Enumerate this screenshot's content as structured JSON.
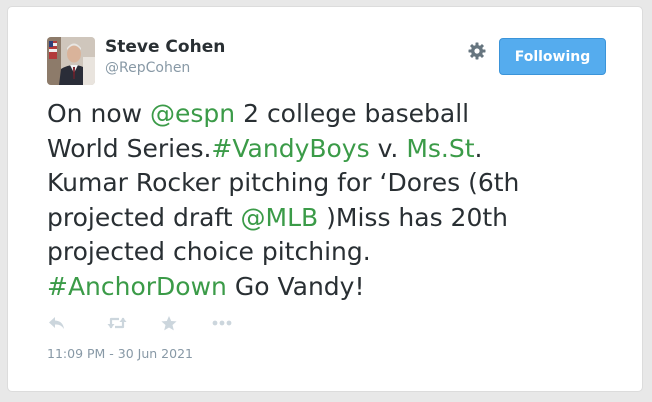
{
  "user": {
    "name": "Steve Cohen",
    "handle": "@RepCohen"
  },
  "follow_button": {
    "label": "Following"
  },
  "tweet": {
    "lines": [
      [
        {
          "text": "On now ",
          "type": "text"
        },
        {
          "text": "@espn",
          "type": "link"
        },
        {
          "text": " 2 college baseball",
          "type": "text"
        }
      ],
      [
        {
          "text": "World Series.",
          "type": "text"
        },
        {
          "text": "#VandyBoys",
          "type": "link"
        },
        {
          "text": " v. ",
          "type": "text"
        },
        {
          "text": "Ms.St",
          "type": "link"
        },
        {
          "text": ".",
          "type": "text"
        }
      ],
      [
        {
          "text": "Kumar Rocker pitching for ‘Dores (6th",
          "type": "text"
        }
      ],
      [
        {
          "text": "projected draft ",
          "type": "text"
        },
        {
          "text": "@MLB",
          "type": "link"
        },
        {
          "text": " )Miss has 20th",
          "type": "text"
        }
      ],
      [
        {
          "text": "projected choice pitching.",
          "type": "text"
        }
      ],
      [
        {
          "text": "#AnchorDown",
          "type": "link"
        },
        {
          "text": " Go Vandy!",
          "type": "text"
        }
      ]
    ]
  },
  "actions": [
    "reply-icon",
    "retweet-icon",
    "like-star-icon",
    "more-icon"
  ],
  "timestamp": "11:09 PM - 30 Jun 2021",
  "colors": {
    "link": "#3b9b48",
    "button": "#55acee",
    "text": "#292f33",
    "muted": "#8899a6",
    "icon": "#ccd6dd"
  }
}
